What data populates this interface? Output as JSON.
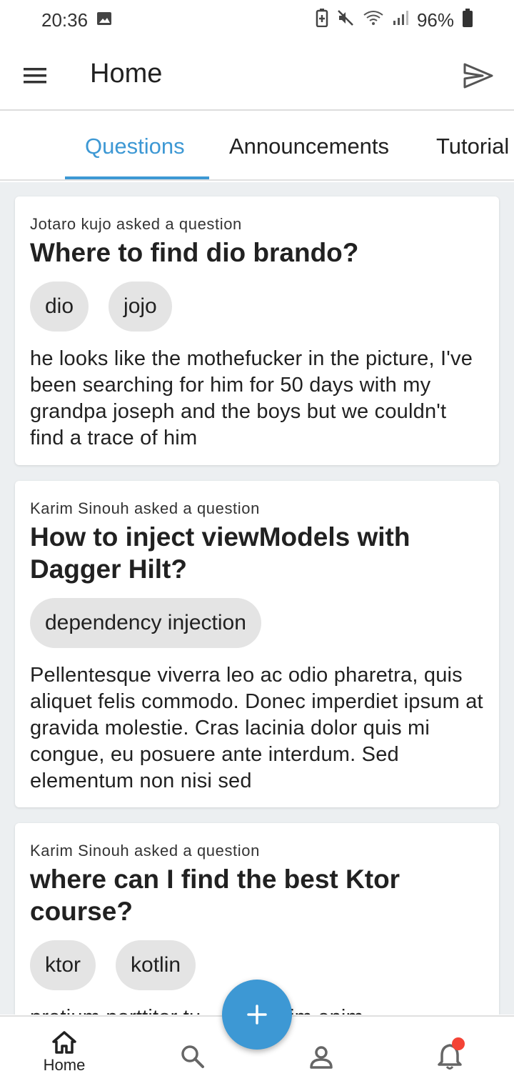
{
  "status_bar": {
    "time": "20:36",
    "battery": "96%",
    "icons": [
      "image-icon",
      "battery-saver-icon",
      "mute-icon",
      "wifi-icon",
      "signal-icon",
      "battery-icon"
    ]
  },
  "app_bar": {
    "title": "Home",
    "menu_icon": "menu-icon",
    "send_icon": "send-icon"
  },
  "tabs": [
    {
      "label": "Questions",
      "active": true
    },
    {
      "label": "Announcements",
      "active": false
    },
    {
      "label": "Tutorial",
      "active": false
    }
  ],
  "questions": [
    {
      "author_line": "Jotaro kujo asked a question",
      "title": "Where to find dio brando?",
      "tags": [
        "dio",
        "jojo"
      ],
      "body": "he looks like the mothefucker in the picture, I've been searching for him for 50 days with my grandpa joseph and the boys but we couldn't find a trace of him"
    },
    {
      "author_line": "Karim Sinouh asked a question",
      "title": "How to inject viewModels with Dagger Hilt?",
      "tags": [
        "dependency injection"
      ],
      "body": "Pellentesque viverra leo ac odio pharetra, quis aliquet felis commodo. Donec imperdiet ipsum at gravida molestie. Cras lacinia dolor quis mi congue, eu posuere ante interdum. Sed elementum non nisi sed"
    },
    {
      "author_line": "Karim Sinouh asked a question",
      "title": "where can I find the best Ktor course?",
      "tags": [
        "ktor",
        "kotlin"
      ],
      "body": "pretium porttitor tu... dignissim enim"
    }
  ],
  "bottom_nav": {
    "items": [
      {
        "label": "Home",
        "icon": "home-icon",
        "active": true
      },
      {
        "label": "",
        "icon": "search-icon",
        "active": false
      },
      {
        "label": "",
        "icon": "profile-icon",
        "active": false
      },
      {
        "label": "",
        "icon": "notification-bell-icon",
        "active": false
      }
    ]
  },
  "fab": {
    "icon": "add-icon",
    "symbol": "+"
  },
  "colors": {
    "accent": "#3d98d4",
    "feed_background": "#eceff1",
    "chip_background": "#e4e4e4",
    "notification_dot": "#f44336"
  }
}
